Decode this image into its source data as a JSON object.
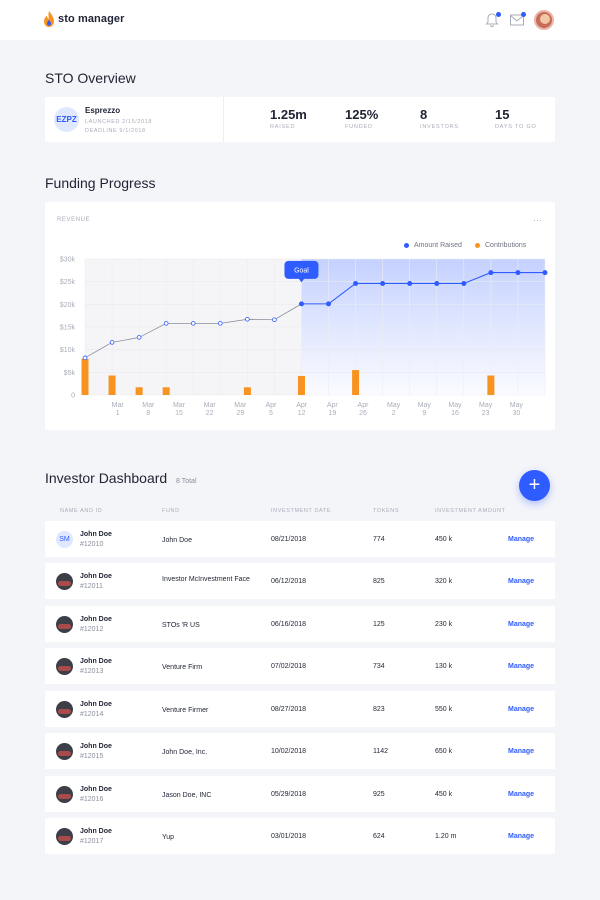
{
  "app": {
    "title": "sto manager"
  },
  "header": {
    "icons": [
      "bell-icon",
      "mail-icon",
      "user-avatar"
    ],
    "accent": "#2f5cff"
  },
  "overview": {
    "title": "STO Overview",
    "project": {
      "initials": "EZPZ",
      "name": "Esprezzo",
      "launched": "LAUNCHED 2/15/2018",
      "deadline": "DEADLINE 9/1/2018"
    },
    "stats": [
      {
        "value": "1.25m",
        "label": "RAISED"
      },
      {
        "value": "125%",
        "label": "FUNDED"
      },
      {
        "value": "8",
        "label": "INVESTORS"
      },
      {
        "value": "15",
        "label": "DAYS TO GO"
      }
    ]
  },
  "funding": {
    "title": "Funding Progress",
    "card_label": "REVENUE",
    "more": "···",
    "goal_label": "Goal"
  },
  "chart_data": {
    "type": "line",
    "title": "REVENUE",
    "categories": [
      "",
      "Mar 1",
      "Mar 8",
      "Mar 15",
      "Mar 22",
      "Mar 29",
      "Apr 5",
      "Apr 12",
      "Apr 19",
      "Apr 26",
      "May 2",
      "May 9",
      "May 16",
      "May 23",
      "May 30",
      ""
    ],
    "tick_labels": [
      {
        "top": "Mar",
        "bottom": "1"
      },
      {
        "top": "Mar",
        "bottom": "8"
      },
      {
        "top": "Mar",
        "bottom": "15"
      },
      {
        "top": "Mar",
        "bottom": "22"
      },
      {
        "top": "Mar",
        "bottom": "29"
      },
      {
        "top": "Apr",
        "bottom": "5"
      },
      {
        "top": "Apr",
        "bottom": "12"
      },
      {
        "top": "Apr",
        "bottom": "19"
      },
      {
        "top": "Apr",
        "bottom": "26"
      },
      {
        "top": "May",
        "bottom": "2"
      },
      {
        "top": "May",
        "bottom": "9"
      },
      {
        "top": "May",
        "bottom": "16"
      },
      {
        "top": "May",
        "bottom": "23"
      },
      {
        "top": "May",
        "bottom": "30"
      }
    ],
    "y_ticks": [
      "0",
      "$5k",
      "$10k",
      "$15k",
      "$20k",
      "$25k",
      "$30k"
    ],
    "ylim": [
      0,
      30000
    ],
    "series": [
      {
        "name": "Amount Raised",
        "color": "#2f5cff",
        "values": [
          8200,
          11600,
          12700,
          15800,
          15800,
          15800,
          16700,
          16600,
          20100,
          20100,
          24600,
          24600,
          24600,
          24600,
          24600,
          27000,
          27000,
          27000
        ]
      },
      {
        "name": "Contributions",
        "color": "#f7931e",
        "values": [
          8000,
          4300,
          1700,
          1700,
          null,
          null,
          1700,
          null,
          4200,
          null,
          5500,
          null,
          null,
          null,
          null,
          4300,
          null,
          null
        ]
      }
    ],
    "goal_index": 8,
    "legend": "top-right",
    "grid": true
  },
  "investors": {
    "title": "Investor Dashboard",
    "total": "8 Total",
    "add_label": "+",
    "columns": [
      "NAME AND ID",
      "FUND",
      "INVESTMENT DATE",
      "TOKENS",
      "INVESTMENT AMOUNT"
    ],
    "action_label": "Manage",
    "rows": [
      {
        "initials": "SM",
        "name": "John Doe",
        "id": "#12010",
        "fund": "John Doe",
        "date": "08/21/2018",
        "tokens": "774",
        "amount": "450 k"
      },
      {
        "initials": "",
        "name": "John Doe",
        "id": "#12011",
        "fund": "Investor McInvestment Face",
        "date": "06/12/2018",
        "tokens": "825",
        "amount": "320 k"
      },
      {
        "initials": "",
        "name": "John Doe",
        "id": "#12012",
        "fund": "STOs 'R US",
        "date": "06/16/2018",
        "tokens": "125",
        "amount": "230 k"
      },
      {
        "initials": "",
        "name": "John Doe",
        "id": "#12013",
        "fund": "Venture Firm",
        "date": "07/02/2018",
        "tokens": "734",
        "amount": "130 k"
      },
      {
        "initials": "",
        "name": "John Doe",
        "id": "#12014",
        "fund": "Venture Firmer",
        "date": "08/27/2018",
        "tokens": "823",
        "amount": "550 k"
      },
      {
        "initials": "",
        "name": "John Doe",
        "id": "#12015",
        "fund": "John Doe, Inc.",
        "date": "10/02/2018",
        "tokens": "1142",
        "amount": "650 k"
      },
      {
        "initials": "",
        "name": "John Doe",
        "id": "#12016",
        "fund": "Jason Doe, INC",
        "date": "05/29/2018",
        "tokens": "925",
        "amount": "450 k"
      },
      {
        "initials": "",
        "name": "John Doe",
        "id": "#12017",
        "fund": "Yup",
        "date": "03/01/2018",
        "tokens": "624",
        "amount": "1.20 m"
      }
    ]
  }
}
